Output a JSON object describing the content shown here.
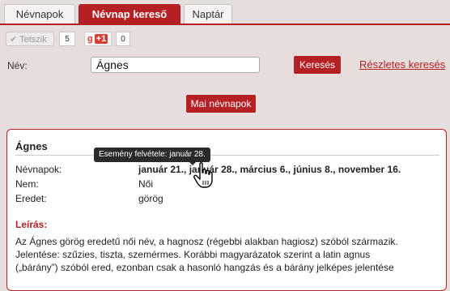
{
  "tabs": [
    {
      "label": "Névnapok",
      "active": false
    },
    {
      "label": "Névnap kereső",
      "active": true
    },
    {
      "label": "Naptár",
      "active": false
    }
  ],
  "social": {
    "like_label": "Tetszik",
    "like_count": "5",
    "gplus_g": "g",
    "gplus_label": "+1",
    "gplus_count": "0"
  },
  "search": {
    "label": "Név:",
    "value": "Ágnes",
    "submit_label": "Keresés",
    "advanced_label": "Részletes keresés"
  },
  "today_button": "Mai névnapok",
  "result": {
    "name": "Ágnes",
    "namedays_label": "Névnapok:",
    "namedays": [
      {
        "text": "január 21.,",
        "sep": " "
      },
      {
        "text": "január 28.,",
        "sep": " "
      },
      {
        "text": "március 6.,",
        "sep": " "
      },
      {
        "text": "június 8.,",
        "sep": " "
      },
      {
        "text": "november 16.",
        "sep": ""
      }
    ],
    "gender_label": "Nem:",
    "gender": "Női",
    "origin_label": "Eredet:",
    "origin": "görög",
    "description_heading": "Leírás:",
    "description": [
      "Az Ágnes görög eredetű női név, a hagnosz (régebbi alakban hagiosz) szóból származik.",
      "Jelentése: szűzies, tiszta, szemérmes. Korábbi magyarázatok szerint a latin agnus",
      "(„bárány”) szóból ered, ezonban csak a hasonló hangzás és a bárány jelképes jelentése"
    ]
  },
  "tooltip": "Esemény felvétele: január 28.",
  "colors": {
    "accent": "#b52025",
    "background": "#e6dedd"
  },
  "icons": {
    "like": "checkmark-icon",
    "cursor": "hand-pointer-icon"
  }
}
